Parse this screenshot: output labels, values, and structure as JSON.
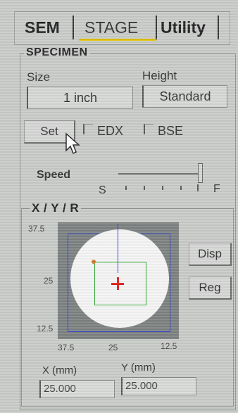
{
  "tabs": [
    {
      "label": "SEM"
    },
    {
      "label": "STAGE"
    },
    {
      "label": "Utility"
    }
  ],
  "specimen": {
    "title": "SPECIMEN",
    "size_label": "Size",
    "size_value": "1 inch",
    "height_label": "Height",
    "height_value": "Standard",
    "set_label": "Set",
    "edx_label": "EDX",
    "bse_label": "BSE",
    "speed_label": "Speed",
    "speed_min": "S",
    "speed_max": "F",
    "speed_level": 1.0
  },
  "xyr": {
    "title": "X / Y / R",
    "y_top": "37.5",
    "y_mid": "25",
    "y_bottom": "12.5",
    "x_left": "37.5",
    "x_mid": "25",
    "x_right": "12.5",
    "disp_label": "Disp",
    "reg_label": "Reg",
    "x_label": "X (mm)",
    "y_label": "Y (mm)",
    "x_value": "25.000",
    "y_value": "25.000"
  },
  "colors": {
    "stage_bg": "#7c8180",
    "disc": "#f4f4f4",
    "frame_blue": "#2c3fd0",
    "marker_red": "#e0201a",
    "view_green": "#2aa62a",
    "tab_highlight": "#e0c200"
  }
}
